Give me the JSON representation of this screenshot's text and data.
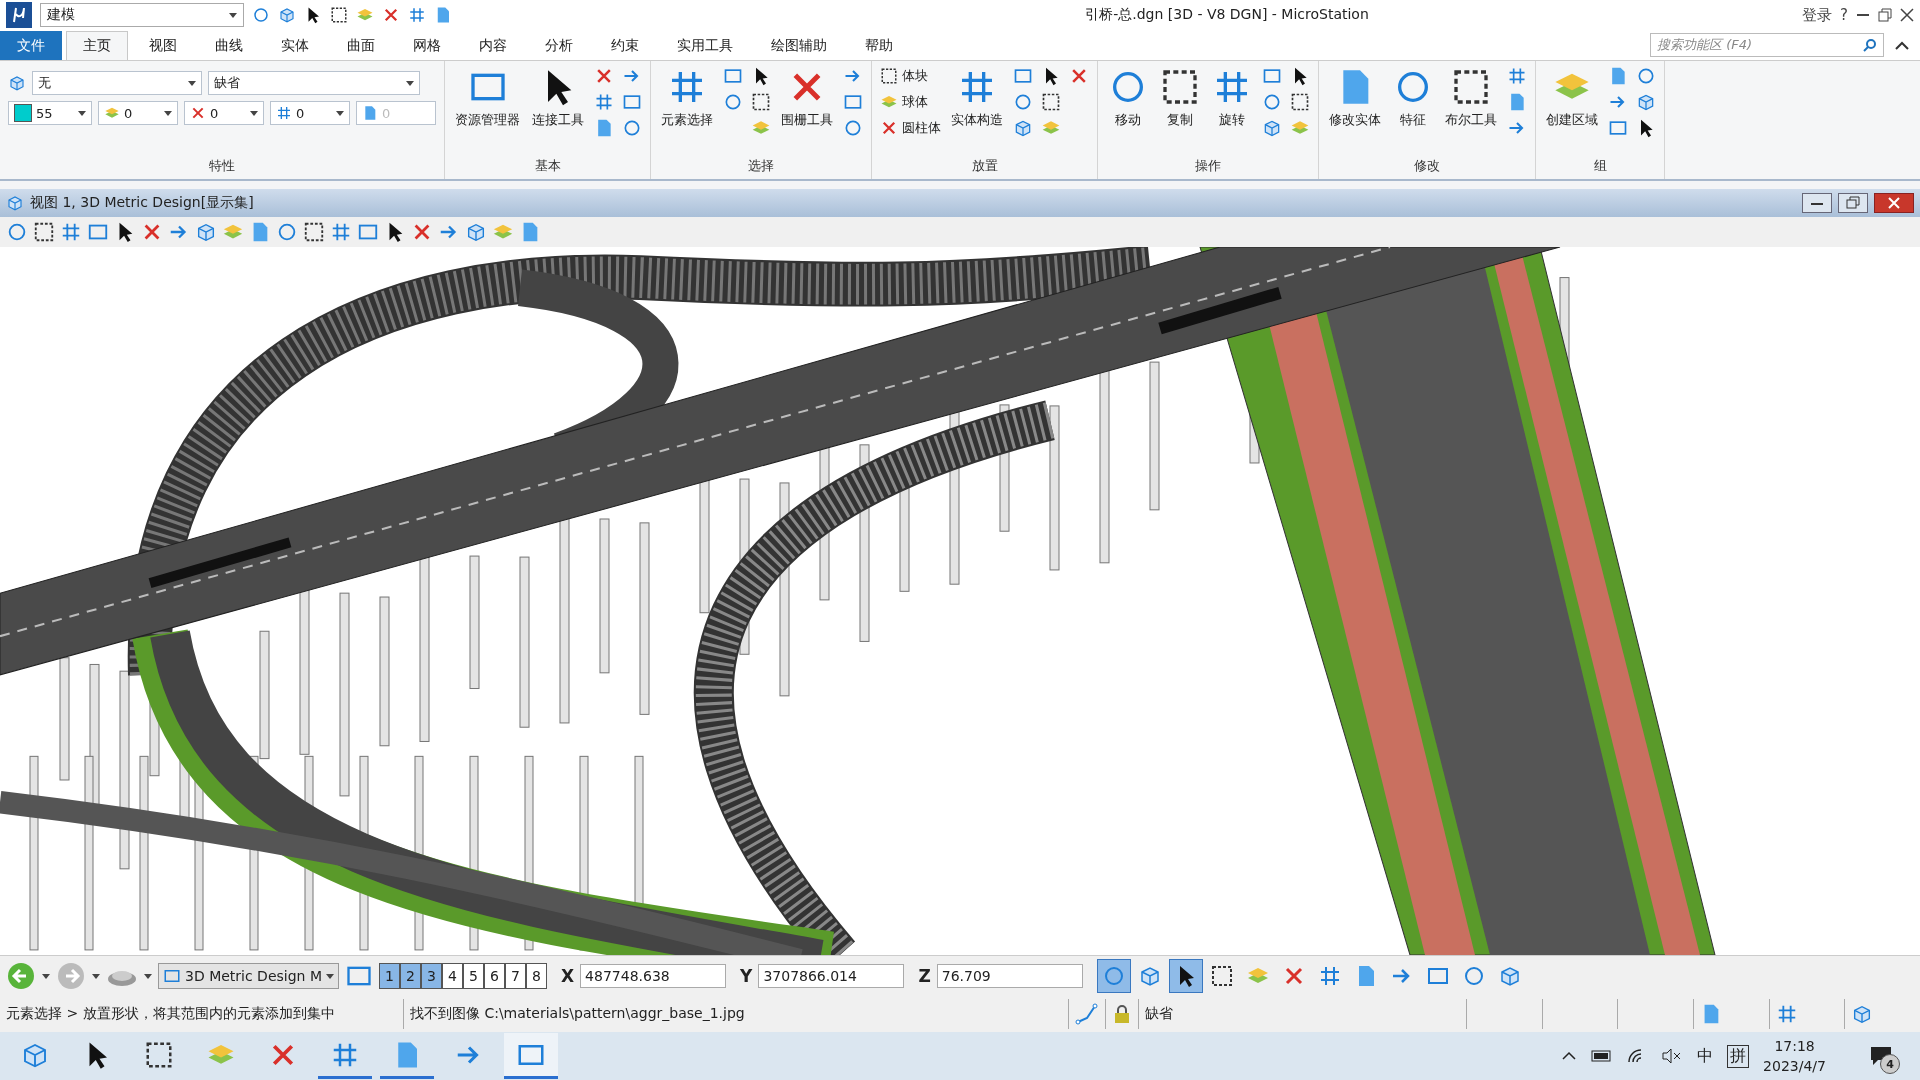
{
  "title_bar": {
    "workflow": "建模",
    "title": "引桥-总.dgn [3D - V8 DGN] - MicroStation",
    "login": "登录",
    "help": "?"
  },
  "ribbon_tabs": [
    {
      "label": "文件",
      "kind": "file",
      "selected": false
    },
    {
      "label": "主页",
      "kind": "tab",
      "selected": true
    },
    {
      "label": "视图",
      "kind": "tab",
      "selected": false
    },
    {
      "label": "曲线",
      "kind": "tab",
      "selected": false
    },
    {
      "label": "实体",
      "kind": "tab",
      "selected": false
    },
    {
      "label": "曲面",
      "kind": "tab",
      "selected": false
    },
    {
      "label": "网格",
      "kind": "tab",
      "selected": false
    },
    {
      "label": "内容",
      "kind": "tab",
      "selected": false
    },
    {
      "label": "分析",
      "kind": "tab",
      "selected": false
    },
    {
      "label": "约束",
      "kind": "tab",
      "selected": false
    },
    {
      "label": "实用工具",
      "kind": "tab",
      "selected": false
    },
    {
      "label": "绘图辅助",
      "kind": "tab",
      "selected": false
    },
    {
      "label": "帮助",
      "kind": "tab",
      "selected": false
    }
  ],
  "ribbon_search": {
    "placeholder": "搜索功能区 (F4)"
  },
  "properties": {
    "title": "特性",
    "level": "无",
    "template": "缺省",
    "attributes": [
      {
        "kind": "color",
        "value": "55",
        "color": "#00cccc",
        "disabled": false
      },
      {
        "kind": "style",
        "value": "0",
        "disabled": false
      },
      {
        "kind": "weight",
        "value": "0",
        "disabled": false
      },
      {
        "kind": "transparency",
        "value": "0",
        "disabled": false
      },
      {
        "kind": "priority",
        "value": "0",
        "disabled": true
      }
    ]
  },
  "ribbon_groups": [
    {
      "title": "基本",
      "columns": [
        [
          {
            "kind": "large",
            "label": "资源管理器"
          }
        ],
        [
          {
            "kind": "large",
            "label": "连接工具"
          }
        ],
        [
          {
            "kind": "icon"
          },
          {
            "kind": "icon"
          },
          {
            "kind": "icon"
          }
        ],
        [
          {
            "kind": "icon"
          },
          {
            "kind": "icon"
          },
          {
            "kind": "icon"
          }
        ]
      ]
    },
    {
      "title": "选择",
      "columns": [
        [
          {
            "kind": "large",
            "label": "元素选择"
          }
        ],
        [
          {
            "kind": "icon"
          },
          {
            "kind": "icon"
          }
        ],
        [
          {
            "kind": "icon"
          },
          {
            "kind": "icon"
          },
          {
            "kind": "icon"
          }
        ],
        [
          {
            "kind": "large",
            "label": "围栅工具"
          }
        ],
        [
          {
            "kind": "icon"
          },
          {
            "kind": "icon"
          },
          {
            "kind": "icon"
          }
        ]
      ]
    },
    {
      "title": "放置",
      "columns": [
        [
          {
            "kind": "small",
            "label": "体块"
          },
          {
            "kind": "small",
            "label": "球体"
          },
          {
            "kind": "small",
            "label": "圆柱体"
          }
        ],
        [
          {
            "kind": "large",
            "label": "实体构造"
          }
        ],
        [
          {
            "kind": "icon"
          },
          {
            "kind": "icon"
          },
          {
            "kind": "icon"
          }
        ],
        [
          {
            "kind": "icon"
          },
          {
            "kind": "icon"
          },
          {
            "kind": "icon"
          }
        ],
        [
          {
            "kind": "icon"
          }
        ]
      ]
    },
    {
      "title": "操作",
      "columns": [
        [
          {
            "kind": "large",
            "label": "移动"
          }
        ],
        [
          {
            "kind": "large",
            "label": "复制"
          }
        ],
        [
          {
            "kind": "large",
            "label": "旋转"
          }
        ],
        [
          {
            "kind": "icon"
          },
          {
            "kind": "icon"
          },
          {
            "kind": "icon"
          }
        ],
        [
          {
            "kind": "icon"
          },
          {
            "kind": "icon"
          },
          {
            "kind": "icon"
          }
        ]
      ]
    },
    {
      "title": "修改",
      "columns": [
        [
          {
            "kind": "large",
            "label": "修改实体"
          }
        ],
        [
          {
            "kind": "large",
            "label": "特征"
          }
        ],
        [
          {
            "kind": "large",
            "label": "布尔工具"
          }
        ],
        [
          {
            "kind": "icon"
          },
          {
            "kind": "icon"
          },
          {
            "kind": "icon"
          }
        ]
      ]
    },
    {
      "title": "组",
      "columns": [
        [
          {
            "kind": "large",
            "label": "创建区域"
          }
        ],
        [
          {
            "kind": "icon"
          },
          {
            "kind": "icon"
          },
          {
            "kind": "icon"
          }
        ],
        [
          {
            "kind": "icon"
          },
          {
            "kind": "icon"
          },
          {
            "kind": "icon"
          }
        ]
      ]
    }
  ],
  "view_window": {
    "title": "视图 1, 3D Metric Design[显示集]"
  },
  "bottom_toolbar": {
    "view_group": "3D Metric Design M",
    "views": [
      {
        "label": "1",
        "selected": true
      },
      {
        "label": "2",
        "selected": true
      },
      {
        "label": "3",
        "selected": true
      },
      {
        "label": "4",
        "selected": false
      },
      {
        "label": "5",
        "selected": false
      },
      {
        "label": "6",
        "selected": false
      },
      {
        "label": "7",
        "selected": false
      },
      {
        "label": "8",
        "selected": false
      }
    ],
    "coordinates": [
      {
        "label": "X",
        "value": "487748.638"
      },
      {
        "label": "Y",
        "value": "3707866.014"
      },
      {
        "label": "Z",
        "value": "76.709"
      }
    ],
    "snaps": [
      {
        "selected": true
      },
      {
        "selected": false
      },
      {
        "selected": true
      },
      {
        "selected": false
      },
      {
        "selected": false
      },
      {
        "selected": false
      },
      {
        "selected": false
      },
      {
        "selected": false
      },
      {
        "selected": false
      },
      {
        "selected": false
      },
      {
        "selected": false
      },
      {
        "selected": false
      }
    ]
  },
  "status_bar": {
    "prompt": "元素选择 > 放置形状，将其范围内的元素添加到集中",
    "message": "找不到图像 C:\\materials\\pattern\\aggr_base_1.jpg",
    "template": "缺省"
  },
  "taskbar": {
    "apps": [
      {
        "running": false,
        "active": false
      },
      {
        "running": false,
        "active": false
      },
      {
        "running": false,
        "active": false
      },
      {
        "running": false,
        "active": false
      },
      {
        "running": false,
        "active": false
      },
      {
        "running": true,
        "active": false
      },
      {
        "running": true,
        "active": false
      },
      {
        "running": false,
        "active": false
      },
      {
        "running": true,
        "active": true
      }
    ],
    "ime": "中",
    "ime_mode": "拼",
    "time": "17:18",
    "date": "2023/4/7",
    "notifications": "4"
  }
}
